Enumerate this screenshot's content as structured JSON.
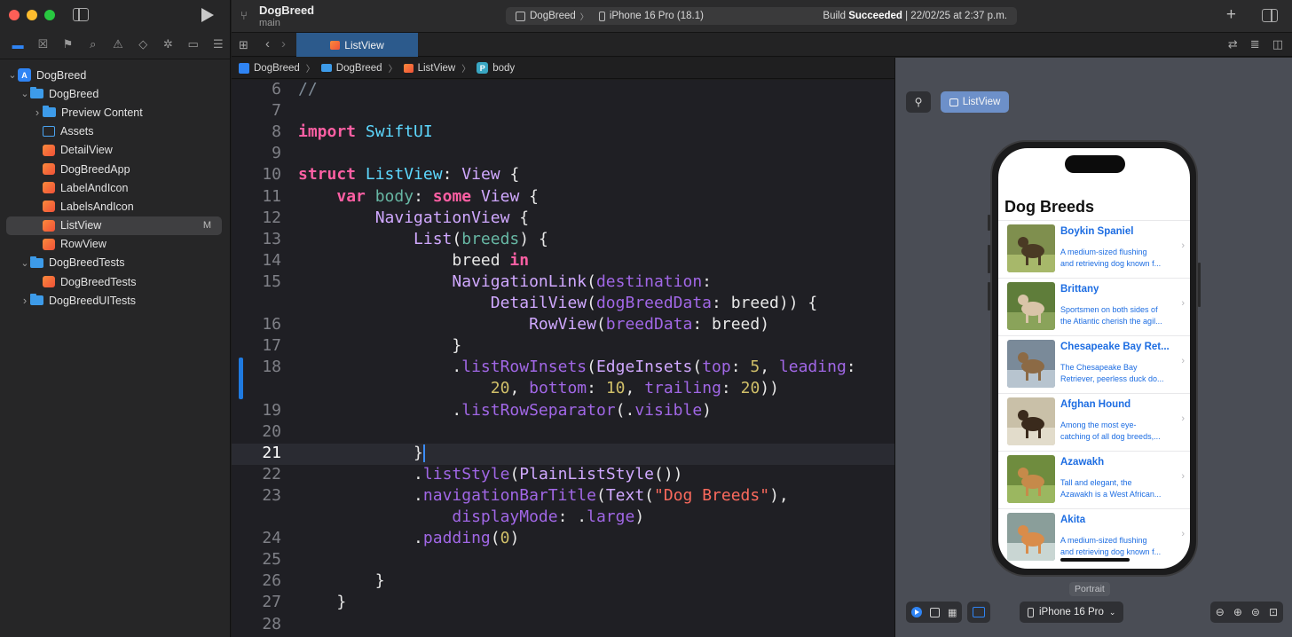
{
  "window": {
    "traffic_colors": [
      "#fe5f57",
      "#febc2e",
      "#28c840"
    ]
  },
  "toolbar": {
    "project_name": "DogBreed",
    "branch": "main",
    "scheme": "DogBreed",
    "destination": "iPhone 16 Pro (18.1)",
    "status_prefix": "Build",
    "status_bold": "Succeeded",
    "status_time": "| 22/02/25 at 2:37 p.m."
  },
  "navigator": {
    "icons": [
      "folder-icon",
      "source-control-icon",
      "bookmark-icon",
      "find-icon",
      "issue-icon",
      "test-icon",
      "debug-icon",
      "breakpoint-icon",
      "report-icon"
    ],
    "tree": [
      {
        "label": "DogBreed",
        "type": "project",
        "depth": 0,
        "expanded": true
      },
      {
        "label": "DogBreed",
        "type": "folder",
        "depth": 1,
        "expanded": true
      },
      {
        "label": "Preview Content",
        "type": "folder",
        "depth": 2,
        "expanded": false
      },
      {
        "label": "Assets",
        "type": "assets",
        "depth": 2
      },
      {
        "label": "DetailView",
        "type": "swift",
        "depth": 2
      },
      {
        "label": "DogBreedApp",
        "type": "swift",
        "depth": 2
      },
      {
        "label": "LabelAndIcon",
        "type": "swift",
        "depth": 2
      },
      {
        "label": "LabelsAndIcon",
        "type": "swift",
        "depth": 2
      },
      {
        "label": "ListView",
        "type": "swift",
        "depth": 2,
        "selected": true,
        "badge": "M"
      },
      {
        "label": "RowView",
        "type": "swift",
        "depth": 2
      },
      {
        "label": "DogBreedTests",
        "type": "folder",
        "depth": 1,
        "expanded": true
      },
      {
        "label": "DogBreedTests",
        "type": "swift",
        "depth": 2
      },
      {
        "label": "DogBreedUITests",
        "type": "folder",
        "depth": 1,
        "expanded": false
      }
    ]
  },
  "tab": {
    "active_label": "ListView"
  },
  "breadcrumb": [
    "DogBreed",
    "DogBreed",
    "ListView",
    "body"
  ],
  "editor": {
    "current_line": 21,
    "lines": [
      {
        "n": "6",
        "text": "//"
      },
      {
        "n": "7",
        "text": ""
      },
      {
        "n": "8",
        "text": "import SwiftUI"
      },
      {
        "n": "9",
        "text": ""
      },
      {
        "n": "10",
        "text": "struct ListView: View {"
      },
      {
        "n": "11",
        "text": "    var body: some View {"
      },
      {
        "n": "12",
        "text": "        NavigationView {"
      },
      {
        "n": "13",
        "text": "            List(breeds) {"
      },
      {
        "n": "14",
        "text": "                breed in"
      },
      {
        "n": "15",
        "text": "                NavigationLink(destination:"
      },
      {
        "n": "",
        "text": "                    DetailView(dogBreedData: breed)) {"
      },
      {
        "n": "16",
        "text": "                        RowView(breedData: breed)"
      },
      {
        "n": "17",
        "text": "                }"
      },
      {
        "n": "18",
        "text": "                .listRowInsets(EdgeInsets(top: 5, leading:"
      },
      {
        "n": "",
        "text": "                    20, bottom: 10, trailing: 20))"
      },
      {
        "n": "19",
        "text": "                .listRowSeparator(.visible)"
      },
      {
        "n": "20",
        "text": ""
      },
      {
        "n": "21",
        "text": "            }"
      },
      {
        "n": "22",
        "text": "            .listStyle(PlainListStyle())"
      },
      {
        "n": "23",
        "text": "            .navigationBarTitle(Text(\"Dog Breeds\"),"
      },
      {
        "n": "",
        "text": "                displayMode: .large)"
      },
      {
        "n": "24",
        "text": "            .padding(0)"
      },
      {
        "n": "25",
        "text": ""
      },
      {
        "n": "26",
        "text": "        }"
      },
      {
        "n": "27",
        "text": "    }"
      },
      {
        "n": "28",
        "text": ""
      }
    ]
  },
  "preview": {
    "chip_label": "ListView",
    "nav_title": "Dog Breeds",
    "rows": [
      {
        "name": "Boykin Spaniel",
        "desc1": "A medium-sized flushing",
        "desc2": "and retrieving dog known f..."
      },
      {
        "name": "Brittany",
        "desc1": "Sportsmen on both sides of",
        "desc2": "the Atlantic cherish the agil..."
      },
      {
        "name": "Chesapeake Bay Ret...",
        "desc1": "The Chesapeake Bay",
        "desc2": "Retriever, peerless duck do..."
      },
      {
        "name": "Afghan Hound",
        "desc1": "Among the most eye-",
        "desc2": "catching of all dog breeds,..."
      },
      {
        "name": "Azawakh",
        "desc1": "Tall and elegant, the",
        "desc2": "Azawakh is a West African..."
      },
      {
        "name": "Akita",
        "desc1": "A medium-sized flushing",
        "desc2": "and retrieving dog known f..."
      }
    ],
    "orientation_label": "Portrait",
    "device_label": "iPhone 16 Pro"
  }
}
